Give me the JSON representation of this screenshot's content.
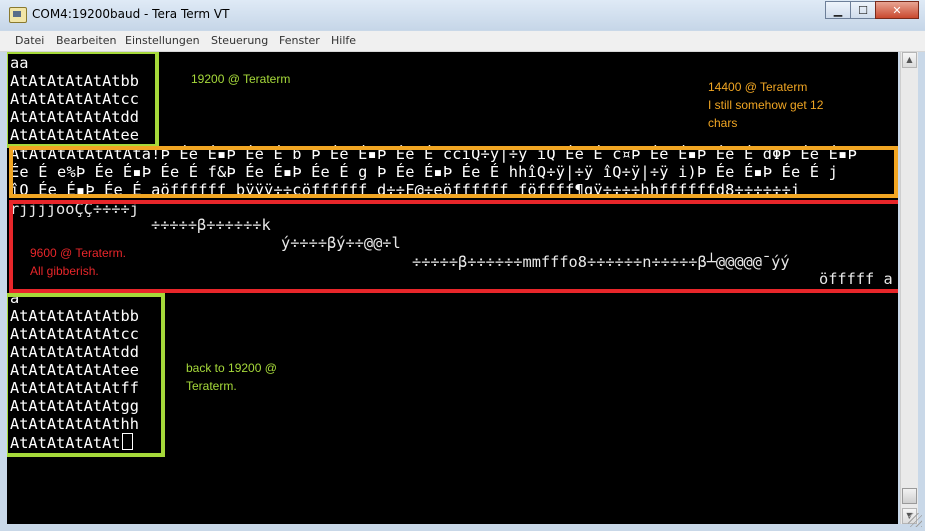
{
  "window": {
    "title": "COM4:19200baud - Tera Term VT",
    "buttons": {
      "minimize": "▁",
      "maximize": "☐",
      "close": "✕"
    }
  },
  "menu": [
    "Datei",
    "Bearbeiten",
    "Einstellungen",
    "Steuerung",
    "Fenster",
    "Hilfe"
  ],
  "terminal": {
    "lines_top": [
      "aa",
      "AtAtAtAtAtAtbb",
      "AtAtAtAtAtAtcc",
      "AtAtAtAtAtAtdd",
      "AtAtAtAtAtAtee"
    ],
    "lines_garbage_14400": [
      "AtAtAtAtAtAtAta!Þ Ée É▪Þ Ée É b Þ Ée É▪Þ Ée É ccîQ÷ÿ|÷ÿ îQ Ée É c¤Þ Ée É▪Þ Ée É dΦÞ Ée É▪Þ",
      "Ée É e%Þ Ée É▪Þ Ée É f&Þ Ée É▪Þ Ée É g Þ Ée É▪Þ Ée É hhîQ÷ÿ|÷ÿ îQ÷ÿ|÷ÿ i)Þ Ée É▪Þ Ée É j",
      "îQ Ée É▪Þ Ée É aöffffff bÿÿÿ÷÷cöffffff d÷÷F@÷eöffffff föffff¶gÿ÷÷÷÷hhffffffd8÷÷÷÷÷÷i"
    ],
    "lines_garbage_9600": [
      "rjjjjooÇÇ÷÷÷÷j",
      "÷÷÷÷÷β÷÷÷÷÷÷k",
      "ý÷÷÷÷βý÷÷@@÷l",
      "÷÷÷÷÷β÷÷÷÷÷÷mmfffo8÷÷÷÷÷÷n÷÷÷÷÷β┴@@@@@¯ýý",
      "öfffff a"
    ],
    "lines_bottom": [
      "a",
      "AtAtAtAtAtAtbb",
      "AtAtAtAtAtAtcc",
      "AtAtAtAtAtAtdd",
      "AtAtAtAtAtAtee",
      "AtAtAtAtAtAtff",
      "AtAtAtAtAtAtgg",
      "AtAtAtAtAtAthh",
      "AtAtAtAtAtAt"
    ]
  },
  "annotations": {
    "note_19200": "19200 @ Teraterm",
    "note_14400_lines": [
      "14400 @ Teraterm",
      "I still somehow get 12",
      "chars"
    ],
    "note_9600_lines": [
      "9600 @ Teraterm.",
      "All gibberish."
    ],
    "note_back_lines": [
      "back to 19200 @",
      "Teraterm."
    ],
    "colors": {
      "green": "#a6d93a",
      "orange": "#f1a623",
      "red": "#e8262a"
    }
  }
}
